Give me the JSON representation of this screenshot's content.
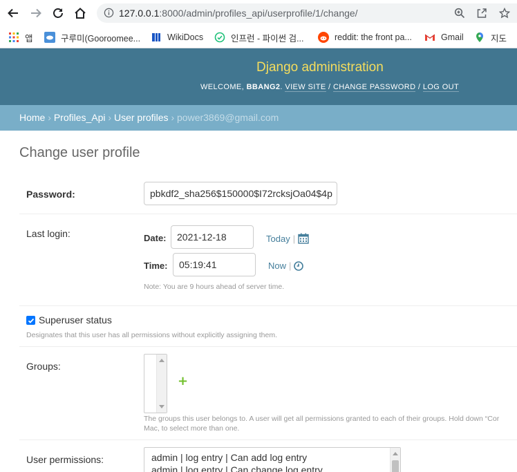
{
  "browser": {
    "url_host": "127.0.0.1",
    "url_rest": ":8000/admin/profiles_api/userprofile/1/change/",
    "bookmarks": [
      {
        "label": "앱"
      },
      {
        "label": "구루미(Gooroomee..."
      },
      {
        "label": "WikiDocs"
      },
      {
        "label": "인프런 - 파이썬 검..."
      },
      {
        "label": "reddit: the front pa..."
      },
      {
        "label": "Gmail"
      },
      {
        "label": "지도"
      }
    ]
  },
  "header": {
    "brand": "Django administration",
    "welcome": "WELCOME,",
    "username": "BBANG2",
    "view_site": "VIEW SITE",
    "change_password": "CHANGE PASSWORD",
    "log_out": "LOG OUT"
  },
  "breadcrumbs": {
    "home": "Home",
    "app": "Profiles_Api",
    "model": "User profiles",
    "current": "power3869@gmail.com",
    "separator": "›"
  },
  "page": {
    "title": "Change user profile"
  },
  "form": {
    "password": {
      "label": "Password:",
      "value": "pbkdf2_sha256$150000$I72rcksjOa04$4p"
    },
    "last_login": {
      "label": "Last login:",
      "date_label": "Date:",
      "date_value": "2021-12-18",
      "today": "Today",
      "time_label": "Time:",
      "time_value": "05:19:41",
      "now": "Now",
      "sep": "|",
      "note": "Note: You are 9 hours ahead of server time."
    },
    "superuser": {
      "label": "Superuser status",
      "checked": true,
      "help": "Designates that this user has all permissions without explicitly assigning them."
    },
    "groups": {
      "label": "Groups:",
      "add": "+",
      "help_line1": "The groups this user belongs to. A user will get all permissions granted to each of their groups. Hold down “Cor",
      "help_line2": "Mac, to select more than one."
    },
    "user_permissions": {
      "label": "User permissions:",
      "options": [
        "admin | log entry | Can add log entry",
        "admin | log entry | Can change log entry"
      ]
    }
  },
  "colors": {
    "header_bg": "#417690",
    "brand": "#f5dd5d",
    "breadcrumbs_bg": "#79aec8",
    "link": "#447e9b",
    "add_green": "#70bf2b"
  }
}
